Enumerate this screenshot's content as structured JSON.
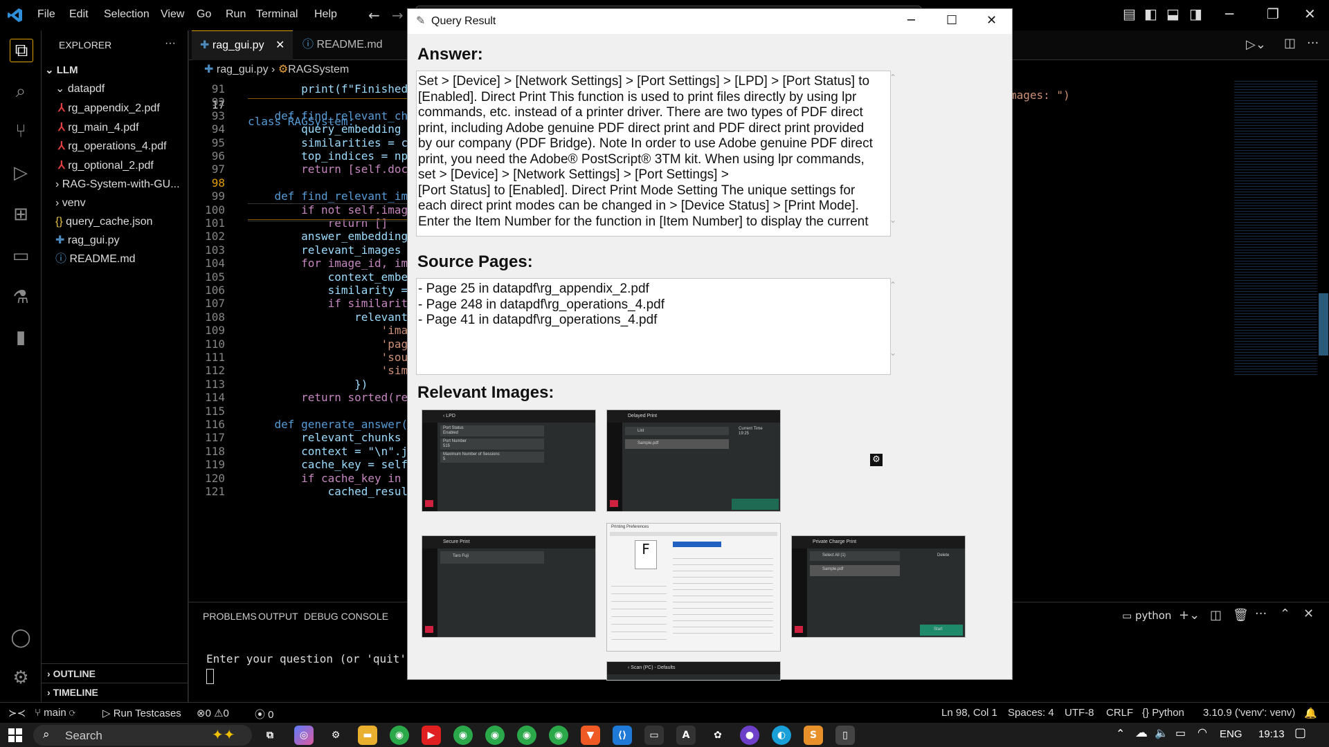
{
  "titlebar": {
    "menu": [
      "File",
      "Edit",
      "Selection",
      "View",
      "Go",
      "Run",
      "Terminal",
      "Help"
    ]
  },
  "sidebar": {
    "header": "EXPLORER",
    "root": "LLM",
    "folder": "datapdf",
    "pdfs": [
      "rg_appendix_2.pdf",
      "rg_main_4.pdf",
      "rg_operations_4.pdf",
      "rg_optional_2.pdf"
    ],
    "other": [
      "RAG-System-with-GU...",
      "venv"
    ],
    "files": [
      "query_cache.json",
      "rag_gui.py",
      "README.md"
    ],
    "outline": "OUTLINE",
    "timeline": "TIMELINE"
  },
  "editor": {
    "tabs": [
      "rag_gui.py",
      "README.md"
    ],
    "breadcrumb_file": "rag_gui.py",
    "breadcrumb_symbol": "RAGSystem",
    "sticky": {
      "num": "17",
      "text": "class RAGSystem:"
    },
    "lines": [
      {
        "num": "91",
        "text": "        print(f\"Finished"
      },
      {
        "num": "92",
        "text": ""
      },
      {
        "num": "93",
        "text": "    def find_relevant_ch"
      },
      {
        "num": "94",
        "text": "        query_embedding"
      },
      {
        "num": "95",
        "text": "        similarities = c"
      },
      {
        "num": "96",
        "text": "        top_indices = np"
      },
      {
        "num": "97",
        "text": "        return [self.doc"
      },
      {
        "num": "98",
        "text": ""
      },
      {
        "num": "99",
        "text": "    def find_relevant_im"
      },
      {
        "num": "100",
        "text": "        if not self.imag"
      },
      {
        "num": "101",
        "text": "            return []"
      },
      {
        "num": "102",
        "text": "        answer_embedding"
      },
      {
        "num": "103",
        "text": "        relevant_images"
      },
      {
        "num": "104",
        "text": "        for image_id, im"
      },
      {
        "num": "105",
        "text": "            context_embe"
      },
      {
        "num": "106",
        "text": "            similarity ="
      },
      {
        "num": "107",
        "text": "            if similarit"
      },
      {
        "num": "108",
        "text": "                relevant"
      },
      {
        "num": "109",
        "text": "                    'ima"
      },
      {
        "num": "110",
        "text": "                    'pag"
      },
      {
        "num": "111",
        "text": "                    'sou"
      },
      {
        "num": "112",
        "text": "                    'sim"
      },
      {
        "num": "113",
        "text": "                })"
      },
      {
        "num": "114",
        "text": "        return sorted(re"
      },
      {
        "num": "115",
        "text": ""
      },
      {
        "num": "116",
        "text": "    def generate_answer("
      },
      {
        "num": "117",
        "text": "        relevant_chunks"
      },
      {
        "num": "118",
        "text": "        context = \"\\n\".j"
      },
      {
        "num": "119",
        "text": "        cache_key = self"
      },
      {
        "num": "120",
        "text": "        if cache_key in"
      },
      {
        "num": "121",
        "text": "            cached_resul"
      }
    ],
    "right_fragment": "mages: \")"
  },
  "panel": {
    "tabs": [
      "PROBLEMS",
      "OUTPUT",
      "DEBUG CONSOLE"
    ],
    "terminal_name": "python",
    "terminal_line": "Enter your question (or 'quit' t"
  },
  "statusbar": {
    "branch": "main",
    "run_testcases": "Run Testcases",
    "errors": "0",
    "warnings": "0",
    "ports": "0",
    "position": "Ln 98, Col 1",
    "spaces": "Spaces: 4",
    "encoding": "UTF-8",
    "eol": "CRLF",
    "language": "Python",
    "interpreter": "3.10.9 ('venv': venv)"
  },
  "taskbar": {
    "search": "Search",
    "lang": "ENG",
    "time": "19:13"
  },
  "dialog": {
    "title": "Query Result",
    "answer_heading": "Answer:",
    "answer_lines": [
      "Set > [Device] > [Network Settings] > [Port Settings] > [LPD] > [Port Status] to",
      "[Enabled]. Direct Print This function is used to print files directly by using lpr",
      "commands, etc. instead of a printer driver. There are two types of PDF direct",
      "print, including Adobe genuine PDF direct print and PDF direct print provided",
      "by our company (PDF Bridge). Note In order to use Adobe genuine PDF direct",
      "print, you need the Adobe® PostScript® 3TM kit. When using lpr commands,",
      "set > [Device] > [Network Settings] > [Port Settings] >",
      "[Port Status] to [Enabled]. Direct Print Mode Setting The unique settings for",
      "each direct print modes can be changed in > [Device Status] > [Print Mode].",
      "Enter the Item Number for the function in [Item Number] to display the current"
    ],
    "source_heading": "Source Pages:",
    "source_lines": [
      "- Page 25 in datapdf\\rg_appendix_2.pdf",
      "- Page 248 in datapdf\\rg_operations_4.pdf",
      "- Page 41 in datapdf\\rg_operations_4.pdf"
    ],
    "images_heading": "Relevant Images:",
    "thumbs": {
      "lpd": {
        "title": "LPD",
        "rows": [
          "Port Status",
          "Enabled",
          "Port Number",
          "515",
          "Maximum Number of Sessions",
          "5"
        ]
      },
      "delayed": {
        "title": "Delayed Print",
        "list": "List",
        "file": "Sample.pdf",
        "current_time": "Current Time",
        "time": "19:25"
      },
      "secure": {
        "title": "Secure Print",
        "user": "Taro Fuji"
      },
      "prefs": {
        "title": "Printing Preferences"
      },
      "private": {
        "title": "Private Charge Print",
        "select_all": "Select All (1)",
        "delete": "Delete",
        "file": "Sample.pdf",
        "start": "Start"
      },
      "scan": {
        "title": "Scan (PC) - Defaults"
      }
    }
  }
}
